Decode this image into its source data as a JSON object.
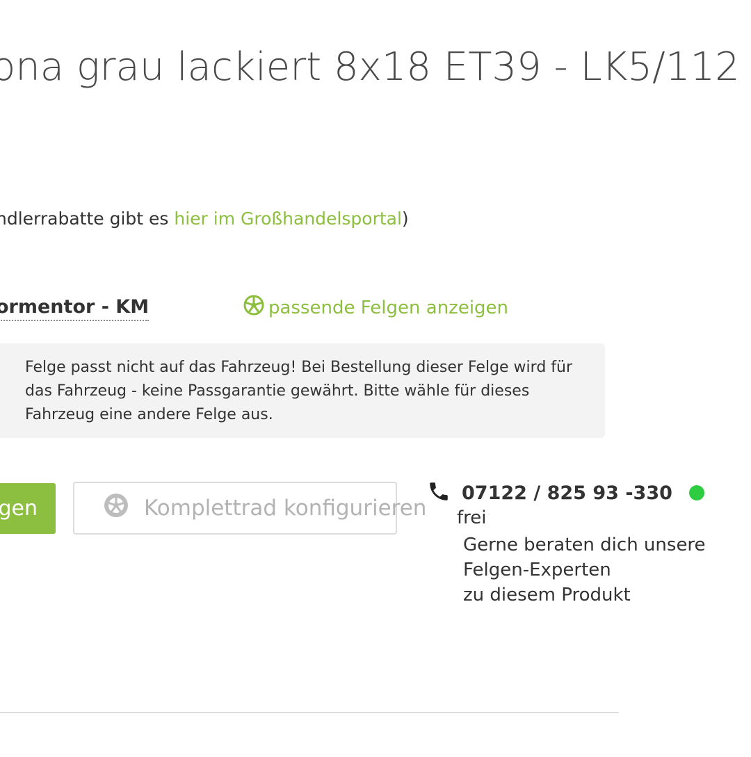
{
  "product": {
    "title": "ona grau lackiert 8x18 ET39 - LK5/112"
  },
  "dealer_note": {
    "prefix": "ndlerrabatte gibt es ",
    "link": "hier im Großhandelsportal",
    "suffix": ")"
  },
  "vehicle": {
    "name": "ormentor - KM",
    "show_rims_label": "passende Felgen anzeigen"
  },
  "warning": {
    "text": "Felge passt nicht auf das Fahrzeug! Bei Bestellung dieser Felge wird für das Fahrzeug - keine Passgarantie gewährt. Bitte wähle für dieses Fahrzeug eine andere Felge aus."
  },
  "actions": {
    "primary_label": "gen",
    "configure_label": "Komplettrad konfigurieren"
  },
  "contact": {
    "phone": "07122 / 825 93 -330",
    "status": "frei",
    "status_color": "#2ecc40",
    "advice_line1": "Gerne beraten dich unsere",
    "advice_line2": "Felgen-Experten",
    "advice_line3": "zu diesem Produkt"
  },
  "colors": {
    "accent": "#8cbf3f"
  },
  "icons": {
    "rim": "wheel-icon",
    "configure": "wheel-icon",
    "phone": "phone-icon"
  }
}
